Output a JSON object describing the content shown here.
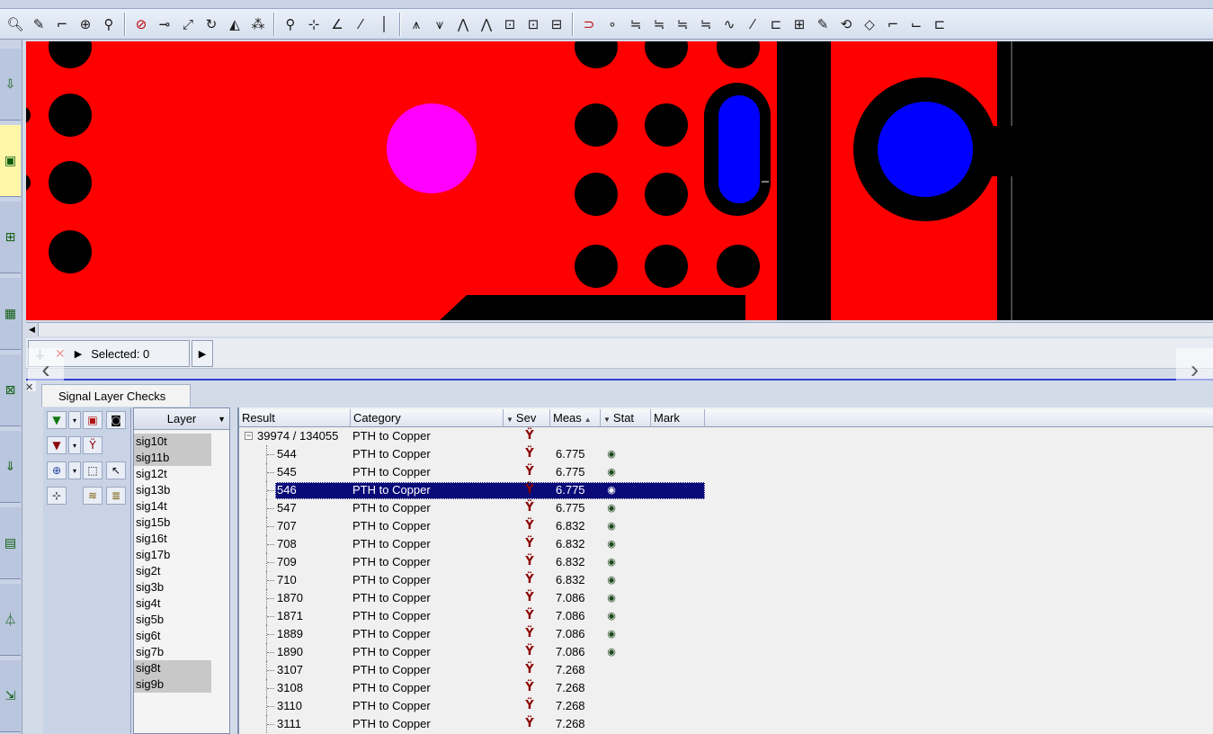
{
  "toolbar": {
    "icons": [
      "zoom-icon",
      "pencil-icon",
      "route-icon",
      "add-pin-icon",
      "probe-icon",
      "no-entry-icon",
      "link-icon",
      "move-icon",
      "rotate-icon",
      "mirror-icon",
      "array-icon",
      "pin-icon",
      "cross-icon",
      "angle-icon",
      "slant-icon",
      "line-icon",
      "stack1-icon",
      "stack2-icon",
      "stack3-icon",
      "stack4-icon",
      "box1-icon",
      "box2-icon",
      "box3-icon",
      "magnet-icon",
      "snap1-icon",
      "snap2-icon",
      "snap3-icon",
      "snap4-icon",
      "snap5-icon",
      "snap6-icon",
      "wand-icon",
      "frame-icon",
      "grid-icon",
      "edit-icon",
      "refresh-icon",
      "diamond-icon",
      "corner1-icon",
      "corner2-icon",
      "corner3-icon"
    ]
  },
  "selection_bar": {
    "selected_label": "Selected: 0"
  },
  "panel": {
    "tab_label": "Signal Layer Checks",
    "layer_header": "Layer",
    "layers": [
      {
        "name": "sig10t",
        "selected": true
      },
      {
        "name": "sig11b",
        "selected": true
      },
      {
        "name": "sig12t",
        "selected": false
      },
      {
        "name": "sig13b",
        "selected": false
      },
      {
        "name": "sig14t",
        "selected": false
      },
      {
        "name": "sig15b",
        "selected": false
      },
      {
        "name": "sig16t",
        "selected": false
      },
      {
        "name": "sig17b",
        "selected": false
      },
      {
        "name": "sig2t",
        "selected": false
      },
      {
        "name": "sig3b",
        "selected": false
      },
      {
        "name": "sig4t",
        "selected": false
      },
      {
        "name": "sig5b",
        "selected": false
      },
      {
        "name": "sig6t",
        "selected": false
      },
      {
        "name": "sig7b",
        "selected": false
      },
      {
        "name": "sig8t",
        "selected": true
      },
      {
        "name": "sig9b",
        "selected": true
      }
    ]
  },
  "grid": {
    "columns": [
      "Result",
      "Category",
      "Sev",
      "Meas",
      "Stat",
      "Mark"
    ],
    "root": {
      "result": "39974 / 134055",
      "category": "PTH to Copper"
    },
    "rows": [
      {
        "result": "544",
        "category": "PTH to Copper",
        "meas": "6.775",
        "stat": true,
        "highlight": false
      },
      {
        "result": "545",
        "category": "PTH to Copper",
        "meas": "6.775",
        "stat": true,
        "highlight": false
      },
      {
        "result": "546",
        "category": "PTH to Copper",
        "meas": "6.775",
        "stat": true,
        "highlight": true
      },
      {
        "result": "547",
        "category": "PTH to Copper",
        "meas": "6.775",
        "stat": true,
        "highlight": false
      },
      {
        "result": "707",
        "category": "PTH to Copper",
        "meas": "6.832",
        "stat": true,
        "highlight": false
      },
      {
        "result": "708",
        "category": "PTH to Copper",
        "meas": "6.832",
        "stat": true,
        "highlight": false
      },
      {
        "result": "709",
        "category": "PTH to Copper",
        "meas": "6.832",
        "stat": true,
        "highlight": false
      },
      {
        "result": "710",
        "category": "PTH to Copper",
        "meas": "6.832",
        "stat": true,
        "highlight": false
      },
      {
        "result": "1870",
        "category": "PTH to Copper",
        "meas": "7.086",
        "stat": true,
        "highlight": false
      },
      {
        "result": "1871",
        "category": "PTH to Copper",
        "meas": "7.086",
        "stat": true,
        "highlight": false
      },
      {
        "result": "1889",
        "category": "PTH to Copper",
        "meas": "7.086",
        "stat": true,
        "highlight": false
      },
      {
        "result": "1890",
        "category": "PTH to Copper",
        "meas": "7.086",
        "stat": true,
        "highlight": false
      },
      {
        "result": "3107",
        "category": "PTH to Copper",
        "meas": "7.268",
        "stat": false,
        "highlight": false
      },
      {
        "result": "3108",
        "category": "PTH to Copper",
        "meas": "7.268",
        "stat": false,
        "highlight": false
      },
      {
        "result": "3110",
        "category": "PTH to Copper",
        "meas": "7.268",
        "stat": false,
        "highlight": false
      },
      {
        "result": "3111",
        "category": "PTH to Copper",
        "meas": "7.268",
        "stat": false,
        "highlight": false
      }
    ]
  },
  "canvas_colors": {
    "copper": "#ff0000",
    "background": "#000000",
    "pad_magenta": "#ff00ff",
    "pad_blue": "#0000ff"
  }
}
